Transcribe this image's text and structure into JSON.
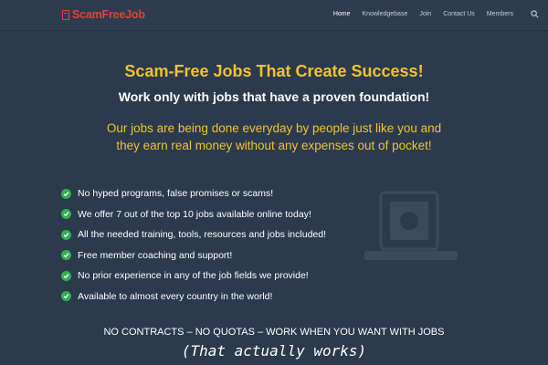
{
  "header": {
    "logo_text": "ScamFreeJob",
    "nav": [
      {
        "label": "Home",
        "active": true
      },
      {
        "label": "Knowledgebase",
        "active": false
      },
      {
        "label": "Join",
        "active": false
      },
      {
        "label": "Contact Us",
        "active": false
      },
      {
        "label": "Members",
        "active": false
      }
    ]
  },
  "hero": {
    "title": "Scam-Free Jobs That Create Success!",
    "subtitle": "Work only with jobs that have a proven foundation!",
    "paragraph": "Our jobs are being done everyday by people just like you and they earn real money without any expenses out of pocket!"
  },
  "features": [
    "No hyped programs, false promises or scams!",
    "We offer 7 out of the top 10 jobs available online today!",
    "All the needed training, tools, resources and jobs included!",
    "Free member coaching and support!",
    "No prior experience in any of the job fields we provide!",
    "Available to almost every country in the world!"
  ],
  "footer_line": "NO CONTRACTS – NO QUOTAS – WORK WHEN YOU WANT WITH JOBS",
  "footer_handwritten": "(That actually works)",
  "colors": {
    "background": "#2b3a4d",
    "accent_yellow": "#f2c230",
    "logo_red": "#d9453a",
    "check_green": "#2eb24f"
  },
  "icons": {
    "logo": "document-icon",
    "search": "search-icon",
    "check": "check-circle-icon"
  }
}
